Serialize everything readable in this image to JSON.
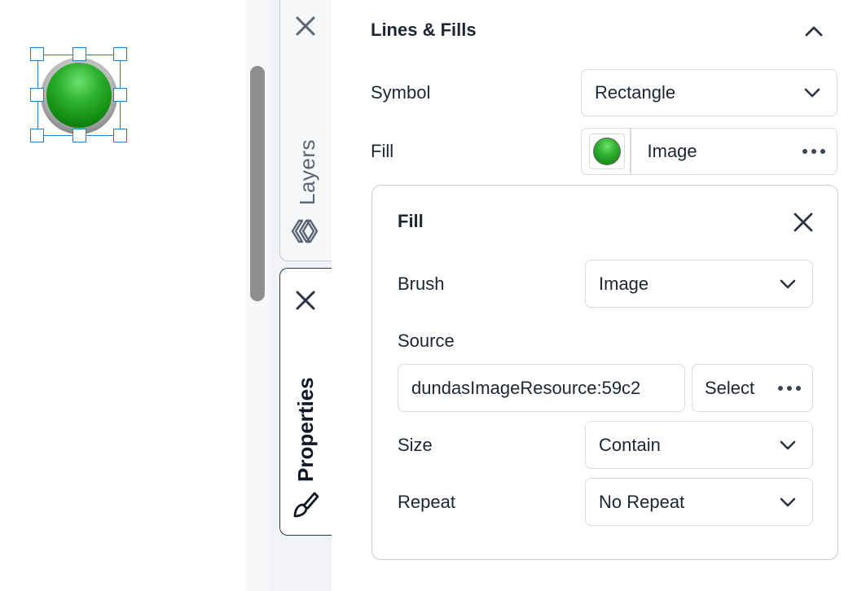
{
  "canvas": {
    "indicator_color": "#2fb22f"
  },
  "tabs": {
    "layers": {
      "label": "Layers",
      "icon": "layers-icon"
    },
    "properties": {
      "label": "Properties",
      "icon": "brush-icon"
    }
  },
  "panel": {
    "section_title": "Lines & Fills",
    "symbol": {
      "label": "Symbol",
      "value": "Rectangle"
    },
    "fill": {
      "label": "Fill",
      "value": "Image"
    }
  },
  "fill_popup": {
    "title": "Fill",
    "brush": {
      "label": "Brush",
      "value": "Image"
    },
    "source": {
      "label": "Source",
      "value": "dundasImageResource:59c2",
      "select_label": "Select"
    },
    "size": {
      "label": "Size",
      "value": "Contain"
    },
    "repeat": {
      "label": "Repeat",
      "value": "No Repeat"
    }
  },
  "colors": {
    "selection": "#1e7ec8",
    "text": "#1c2533",
    "border": "#d6dbe2"
  }
}
